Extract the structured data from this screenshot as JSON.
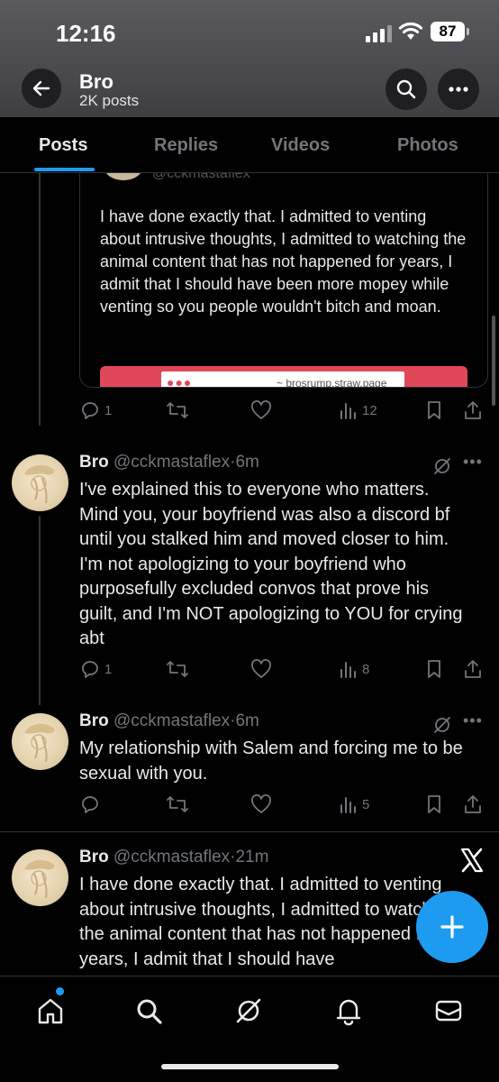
{
  "status_bar": {
    "time": "12:16",
    "battery": "87"
  },
  "header": {
    "name": "Bro",
    "posts_count": "2K posts"
  },
  "tabs": [
    {
      "label": "Posts",
      "active": true
    },
    {
      "label": "Replies",
      "active": false
    },
    {
      "label": "Videos",
      "active": false
    },
    {
      "label": "Photos",
      "active": false
    }
  ],
  "quote": {
    "handle_peek": "@cckmastaflex",
    "text": "I have done exactly that. I admitted to venting about intrusive thoughts, I admitted to watching the animal content that has not happened for years, I admit that I should have been more mopey while venting so you people wouldn't bitch and moan.",
    "link": "~ brosrump.straw.page",
    "dots": "●●●"
  },
  "top_actions": {
    "replies": "1",
    "views": "12"
  },
  "tweets": [
    {
      "name": "Bro",
      "handle": "@cckmastaflex",
      "sep": "·",
      "time": "6m",
      "text": "I've explained this to everyone who matters. Mind you, your boyfriend was also a discord bf until you stalked him and moved closer to him. I'm not apologizing to your boyfriend who purposefully excluded convos that prove his guilt, and I'm NOT apologizing to YOU for crying abt",
      "replies": "1",
      "views": "8"
    },
    {
      "name": "Bro",
      "handle": "@cckmastaflex",
      "sep": "·",
      "time": "6m",
      "text": "My relationship with Salem and forcing me to be sexual with you.",
      "replies": "",
      "views": "5"
    },
    {
      "name": "Bro",
      "handle": "@cckmastaflex",
      "sep": "·",
      "time": "21m",
      "text": "I have done exactly that. I admitted to venting about intrusive thoughts, I admitted to watching the animal content that has not happened for years, I admit that I should have"
    }
  ],
  "colors": {
    "accent": "#1d9bf0",
    "muted": "#71767b",
    "background": "#000000"
  },
  "icons": [
    "back-arrow-icon",
    "search-icon",
    "more-icon",
    "reply-icon",
    "repost-icon",
    "like-icon",
    "views-icon",
    "bookmark-icon",
    "share-icon",
    "grok-icon",
    "x-logo-icon",
    "compose-plus-icon",
    "home-icon",
    "explore-icon",
    "grok-nav-icon",
    "notifications-icon",
    "messages-icon"
  ]
}
